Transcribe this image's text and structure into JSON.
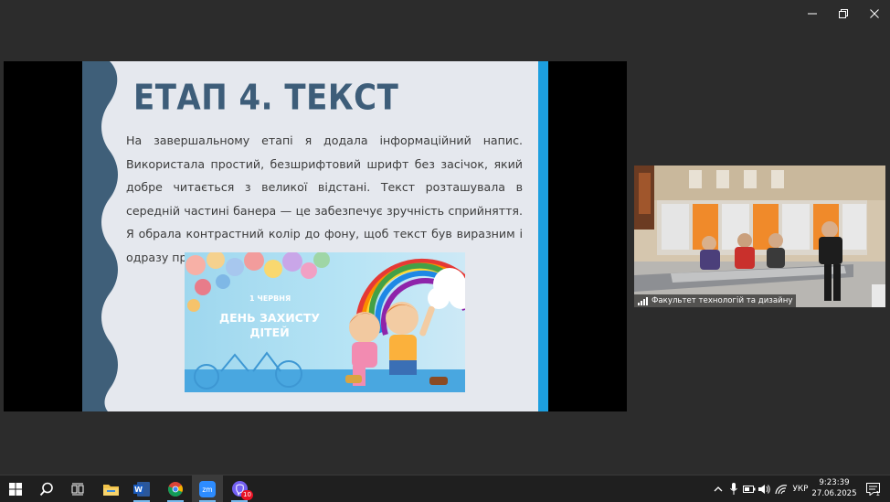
{
  "window": {
    "controls": [
      "minimize",
      "restore",
      "close"
    ]
  },
  "slide": {
    "title": "ЕТАП 4. ТЕКСТ",
    "body": "На завершальному етапі я додала інформаційний напис. Використала простий, безшрифтовий шрифт без засічок, який добре читається з великої відстані. Текст розташувала в середній частині банера — це забезпечує зручність сприйняття. Я обрала контрастний колір до фону, щоб текст був виразним і одразу привертав увагу.",
    "banner": {
      "date": "1 ЧЕРВНЯ",
      "line1": "ДЕНЬ ЗАХИСТУ",
      "line2": "ДІТЕЙ"
    },
    "colors": {
      "title": "#3d5d79",
      "wave": "#3f5f79",
      "right_bar": "#1c9fe0",
      "background": "#e5e8ee"
    }
  },
  "video": {
    "participant_name": "Факультет технологій та дизайну"
  },
  "taskbar": {
    "apps": [
      {
        "name": "windows-start",
        "icon": "windows-logo-icon"
      },
      {
        "name": "search",
        "icon": "search-icon"
      },
      {
        "name": "task-view",
        "icon": "task-view-icon"
      },
      {
        "name": "file-explorer",
        "icon": "folder-icon"
      },
      {
        "name": "word",
        "icon": "word-icon",
        "label": "W"
      },
      {
        "name": "chrome",
        "icon": "chrome-icon"
      },
      {
        "name": "zoom",
        "icon": "zoom-icon",
        "label": "zm"
      },
      {
        "name": "viber",
        "icon": "viber-icon",
        "badge": "10"
      }
    ],
    "tray": {
      "language": "УКР",
      "time": "9:23:39",
      "date": "27.06.2025",
      "notifications": "1"
    }
  }
}
